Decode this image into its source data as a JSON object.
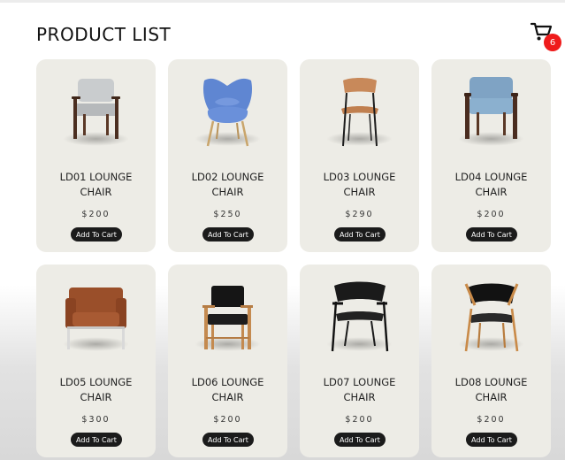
{
  "header": {
    "title": "PRODUCT LIST",
    "cart_icon": "shopping-cart-icon",
    "cart_count": "6",
    "badge_color": "#ef1b1b"
  },
  "products": [
    {
      "name": "LD01 LOUNGE CHAIR",
      "price": "$200",
      "button": "Add To Cart",
      "image": "grey-cushioned-armchair"
    },
    {
      "name": "LD02 LOUNGE CHAIR",
      "price": "$250",
      "button": "Add To Cart",
      "image": "blue-wingback-chair"
    },
    {
      "name": "LD03 LOUNGE CHAIR",
      "price": "$290",
      "button": "Add To Cart",
      "image": "wooden-seat-metal-chair"
    },
    {
      "name": "LD04 LOUNGE CHAIR",
      "price": "$200",
      "button": "Add To Cart",
      "image": "light-blue-lounge-chair"
    },
    {
      "name": "LD05 LOUNGE CHAIR",
      "price": "$300",
      "button": "Add To Cart",
      "image": "brown-leather-armchair"
    },
    {
      "name": "LD06 LOUNGE CHAIR",
      "price": "$200",
      "button": "Add To Cart",
      "image": "black-wood-armchair"
    },
    {
      "name": "LD07 LOUNGE CHAIR",
      "price": "$200",
      "button": "Add To Cart",
      "image": "black-shell-armchair"
    },
    {
      "name": "LD08 LOUNGE CHAIR",
      "price": "$200",
      "button": "Add To Cart",
      "image": "black-oak-lounge-chair"
    }
  ],
  "colors": {
    "card_background": "#edece6",
    "button_background": "#1b1b1b"
  }
}
